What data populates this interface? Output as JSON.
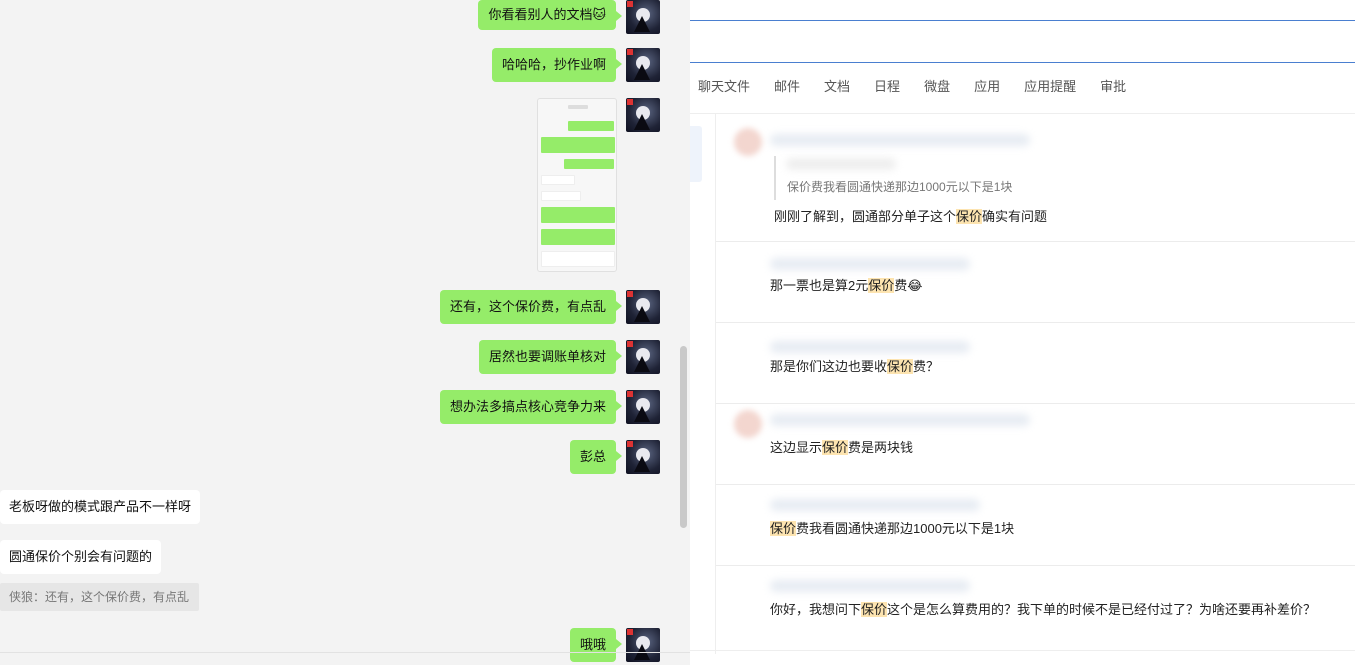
{
  "chat": {
    "outgoing": [
      {
        "text": "你看看别人的文档🐱"
      },
      {
        "text": "哈哈哈，抄作业啊"
      },
      {
        "text": "还有，这个保价费，有点乱"
      },
      {
        "text": "居然也要调账单核对"
      },
      {
        "text": "想办法多搞点核心竞争力来"
      },
      {
        "text": "彭总"
      },
      {
        "text": "哦哦"
      }
    ],
    "incoming": [
      {
        "text": "老板呀做的模式跟产品不一样呀"
      },
      {
        "text": "圆通保价个别会有问题的"
      }
    ],
    "quote": "侠狼：还有，这个保价费，有点乱"
  },
  "tabs": [
    "聊天文件",
    "邮件",
    "文档",
    "日程",
    "微盘",
    "应用",
    "应用提醒",
    "审批"
  ],
  "results": [
    {
      "quote": "保价费我看圆通快递那边1000元以下是1块",
      "pre": "刚刚了解到，圆通部分单子这个",
      "hl": "保价",
      "post": "确实有问题"
    },
    {
      "pre": "那一票也是算2元",
      "hl": "保价",
      "post": "费😂"
    },
    {
      "pre": "那是你们这边也要收",
      "hl": "保价",
      "post": "费？"
    },
    {
      "pre": "这边显示",
      "hl": "保价",
      "post": "费是两块钱"
    },
    {
      "pre": "",
      "hl": "保价",
      "post": "费我看圆通快递那边1000元以下是1块"
    },
    {
      "pre": "你好，我想问下",
      "hl": "保价",
      "post": "这个是怎么算费用的？我下单的时候不是已经付过了？为啥还要再补差价？"
    }
  ],
  "colors": {
    "bubble_out": "#95ec69",
    "highlight": "#fde4b0",
    "accent": "#4a7fd0"
  }
}
